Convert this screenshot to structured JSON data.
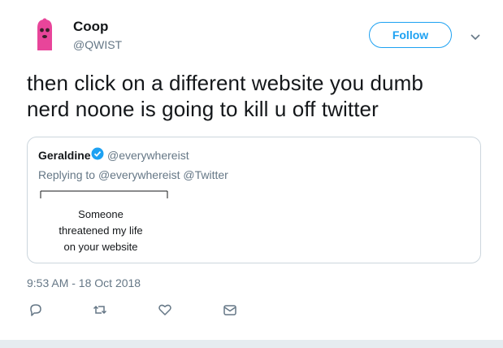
{
  "author": {
    "name": "Coop",
    "handle": "@QWIST"
  },
  "follow_label": "Follow",
  "tweet_text_line1": "then click on a different website you dumb",
  "tweet_text_line2": "nerd noone is going to kill u off twitter",
  "quoted_tweet": {
    "name": "Geraldine",
    "handle": "@everywhereist",
    "replying_prefix": "Replying to",
    "replying_to": [
      "@everywhereist",
      "@Twitter"
    ],
    "body_lines": [
      "Someone",
      "threatened my life",
      "on your website"
    ]
  },
  "timestamp": "9:53 AM - 18 Oct 2018",
  "icons": {
    "avatar": "pink-balaclava-avatar",
    "verified": "verified-badge-icon",
    "caret": "chevron-down-icon",
    "reply": "reply-icon",
    "retweet": "retweet-icon",
    "like": "heart-icon",
    "dm": "envelope-icon"
  },
  "colors": {
    "accent": "#1da1f2",
    "secondary_text": "#657786",
    "border": "#ccd6dd",
    "avatar_pink": "#e8459a"
  }
}
